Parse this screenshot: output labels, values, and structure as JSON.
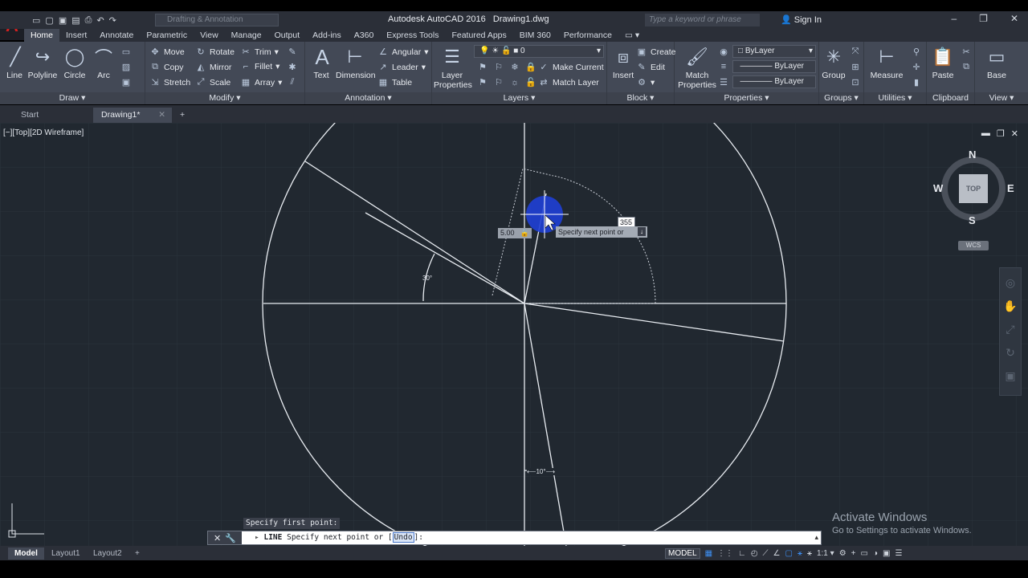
{
  "app": {
    "title": "Autodesk AutoCAD 2016",
    "file": "Drawing1.dwg",
    "logo": "A",
    "workspace": "Drafting & Annotation",
    "search_placeholder": "Type a keyword or phrase",
    "sign_in": "Sign In"
  },
  "ribbon_tabs": [
    "Home",
    "Insert",
    "Annotate",
    "Parametric",
    "View",
    "Manage",
    "Output",
    "Add-ins",
    "A360",
    "Express Tools",
    "Featured Apps",
    "BIM 360",
    "Performance"
  ],
  "panels": {
    "draw": {
      "title": "Draw",
      "line": "Line",
      "polyline": "Polyline",
      "circle": "Circle",
      "arc": "Arc"
    },
    "modify": {
      "title": "Modify",
      "move": "Move",
      "rotate": "Rotate",
      "trim": "Trim",
      "copy": "Copy",
      "mirror": "Mirror",
      "fillet": "Fillet",
      "stretch": "Stretch",
      "scale": "Scale",
      "array": "Array"
    },
    "annotation": {
      "title": "Annotation",
      "text": "Text",
      "dimension": "Dimension",
      "angular": "Angular",
      "leader": "Leader",
      "table": "Table"
    },
    "layers": {
      "title": "Layers",
      "layer_properties_1": "Layer",
      "layer_properties_2": "Properties",
      "current_layer": "0",
      "make_current": "Make Current",
      "match_layer": "Match Layer"
    },
    "block": {
      "title": "Block",
      "insert": "Insert",
      "create": "Create",
      "edit": "Edit"
    },
    "properties": {
      "title": "Properties",
      "match_1": "Match",
      "match_2": "Properties",
      "color": "ByLayer",
      "linetype": "ByLayer",
      "lineweight": "ByLayer"
    },
    "groups": {
      "title": "Groups",
      "group": "Group"
    },
    "utilities": {
      "title": "Utilities",
      "measure": "Measure"
    },
    "clipboard": {
      "title": "Clipboard",
      "paste": "Paste"
    },
    "view": {
      "title": "View",
      "base": "Base"
    }
  },
  "file_tabs": {
    "start": "Start",
    "drawing": "Drawing1*"
  },
  "viewport": {
    "label": "[−][Top][2D Wireframe]",
    "viewcube": {
      "n": "N",
      "s": "S",
      "e": "E",
      "w": "W",
      "top": "TOP",
      "wcs": "WCS"
    },
    "angle_30": "30°",
    "angle_10": "10°",
    "dyn_distance": "5.00",
    "dyn_angle": "355",
    "dyn_prompt": "Specify next point or"
  },
  "command": {
    "history": "Specify first point:",
    "prefix": "LINE",
    "prompt": "Specify next point or [",
    "option": "Undo",
    "suffix": "]:"
  },
  "watermark": {
    "line1": "Activate Windows",
    "line2": "Go to Settings to activate Windows."
  },
  "layout_tabs": [
    "Model",
    "Layout1",
    "Layout2"
  ],
  "status": {
    "model": "MODEL",
    "scale": "1:1"
  },
  "colors": {
    "background": "#212830",
    "ribbon": "#434956",
    "titlebar": "#2b2f38",
    "geometry": "#ffffff",
    "cursor_highlight": "#1f3fd6"
  }
}
